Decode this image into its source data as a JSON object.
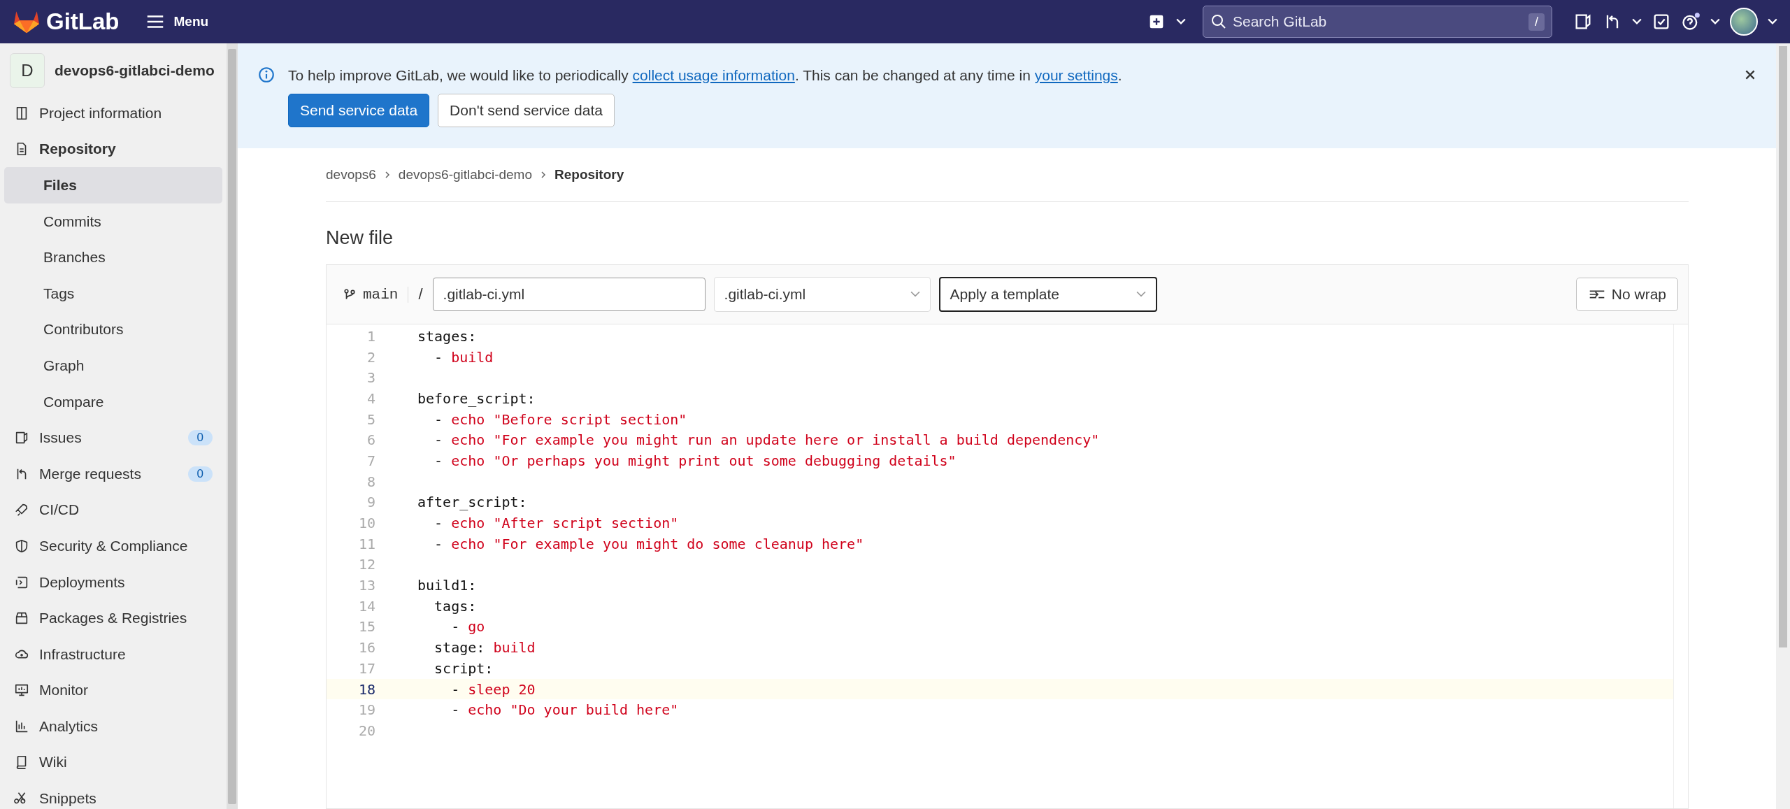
{
  "top_bar": {
    "logo": "GitLab",
    "menu": "Menu",
    "search": {
      "placeholder": "Search GitLab",
      "shortcut": "/"
    }
  },
  "sidebar": {
    "project": {
      "avatar": "D",
      "name": "devops6-gitlabci-demo"
    },
    "items": [
      {
        "label": "Project information",
        "selected": false
      },
      {
        "label": "Repository",
        "selected": true,
        "children": [
          {
            "label": "Files",
            "selected": true
          },
          {
            "label": "Commits",
            "selected": false
          },
          {
            "label": "Branches",
            "selected": false
          },
          {
            "label": "Tags",
            "selected": false
          },
          {
            "label": "Contributors",
            "selected": false
          },
          {
            "label": "Graph",
            "selected": false
          },
          {
            "label": "Compare",
            "selected": false
          }
        ]
      },
      {
        "label": "Issues",
        "selected": false,
        "count": "0"
      },
      {
        "label": "Merge requests",
        "selected": false,
        "count": "0"
      },
      {
        "label": "CI/CD",
        "selected": false
      },
      {
        "label": "Security & Compliance",
        "selected": false
      },
      {
        "label": "Deployments",
        "selected": false
      },
      {
        "label": "Packages & Registries",
        "selected": false
      },
      {
        "label": "Infrastructure",
        "selected": false
      },
      {
        "label": "Monitor",
        "selected": false
      },
      {
        "label": "Analytics",
        "selected": false
      },
      {
        "label": "Wiki",
        "selected": false
      },
      {
        "label": "Snippets",
        "selected": false
      }
    ]
  },
  "banner": {
    "text_before": "To help improve GitLab, we would like to periodically ",
    "link1": "collect usage information",
    "text_middle": ". This can be changed at any time in ",
    "link2": "your settings",
    "text_after": ".",
    "primary_button": "Send service data",
    "secondary_button": "Don't send service data"
  },
  "breadcrumb": [
    "devops6",
    "devops6-gitlabci-demo",
    "Repository"
  ],
  "page_title": "New file",
  "editor": {
    "branch": "main",
    "separator": "/",
    "file_name": ".gitlab-ci.yml",
    "file_type": ".gitlab-ci.yml",
    "template": {
      "placeholder": "Apply a template"
    },
    "wrap_button": "No wrap",
    "lines": [
      {
        "number": "1",
        "text": "stages:",
        "current": false
      },
      {
        "number": "2",
        "text": "  - ",
        "value": "build",
        "current": false
      },
      {
        "number": "3",
        "current": false
      },
      {
        "number": "4",
        "text": "before_script:",
        "current": false
      },
      {
        "number": "5",
        "text": "  - ",
        "value": "echo \"Before script section\"",
        "current": false
      },
      {
        "number": "6",
        "text": "  - ",
        "value": "echo \"For example you might run an update here or install a build dependency\"",
        "current": false
      },
      {
        "number": "7",
        "text": "  - ",
        "value": "echo \"Or perhaps you might print out some debugging details\"",
        "current": false
      },
      {
        "number": "8",
        "current": false
      },
      {
        "number": "9",
        "text": "after_script:",
        "current": false
      },
      {
        "number": "10",
        "text": "  - ",
        "value": "echo \"After script section\"",
        "current": false
      },
      {
        "number": "11",
        "text": "  - ",
        "value": "echo \"For example you might do some cleanup here\"",
        "current": false
      },
      {
        "number": "12",
        "current": false
      },
      {
        "number": "13",
        "text": "build1:",
        "current": false
      },
      {
        "number": "14",
        "text": "  tags:",
        "current": false
      },
      {
        "number": "15",
        "text": "    - ",
        "value": "go",
        "current": false
      },
      {
        "number": "16",
        "text": "  stage: ",
        "value": "build",
        "current": false
      },
      {
        "number": "17",
        "text": "  script:",
        "current": false
      },
      {
        "number": "18",
        "text": "    - ",
        "value": "sleep 20",
        "current": true
      },
      {
        "number": "19",
        "text": "    - ",
        "value": "echo \"Do your build here\"",
        "current": false
      },
      {
        "number": "20",
        "current": false
      }
    ]
  }
}
